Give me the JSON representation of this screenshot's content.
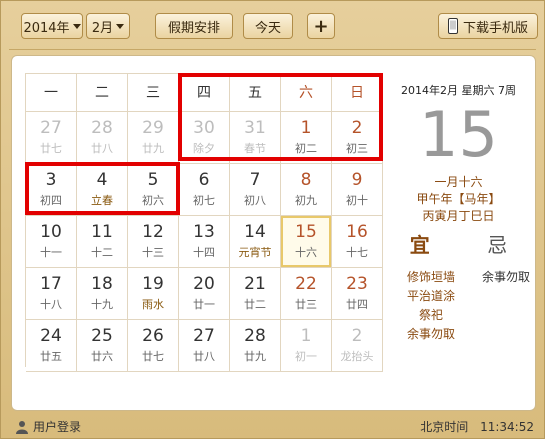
{
  "toolbar": {
    "year": "2014年",
    "month": "2月",
    "holiday_btn": "假期安排",
    "today_btn": "今天",
    "plus_btn": "+",
    "download_btn": "下载手机版"
  },
  "weekdays": [
    "一",
    "二",
    "三",
    "四",
    "五",
    "六",
    "日"
  ],
  "days": [
    {
      "d": "27",
      "l": "廿七",
      "other": true
    },
    {
      "d": "28",
      "l": "廿八",
      "other": true
    },
    {
      "d": "29",
      "l": "廿九",
      "other": true
    },
    {
      "d": "30",
      "l": "除夕",
      "other": true
    },
    {
      "d": "31",
      "l": "春节",
      "other": true
    },
    {
      "d": "1",
      "l": "初二",
      "we": true
    },
    {
      "d": "2",
      "l": "初三",
      "we": true
    },
    {
      "d": "3",
      "l": "初四"
    },
    {
      "d": "4",
      "l": "立春",
      "fest": true
    },
    {
      "d": "5",
      "l": "初六"
    },
    {
      "d": "6",
      "l": "初七"
    },
    {
      "d": "7",
      "l": "初八"
    },
    {
      "d": "8",
      "l": "初九",
      "we": true
    },
    {
      "d": "9",
      "l": "初十",
      "we": true
    },
    {
      "d": "10",
      "l": "十一"
    },
    {
      "d": "11",
      "l": "十二"
    },
    {
      "d": "12",
      "l": "十三"
    },
    {
      "d": "13",
      "l": "十四"
    },
    {
      "d": "14",
      "l": "元宵节",
      "fest": true
    },
    {
      "d": "15",
      "l": "十六",
      "we": true,
      "today": true
    },
    {
      "d": "16",
      "l": "十七",
      "we": true
    },
    {
      "d": "17",
      "l": "十八"
    },
    {
      "d": "18",
      "l": "十九"
    },
    {
      "d": "19",
      "l": "雨水",
      "fest": true
    },
    {
      "d": "20",
      "l": "廿一"
    },
    {
      "d": "21",
      "l": "廿二"
    },
    {
      "d": "22",
      "l": "廿三",
      "we": true
    },
    {
      "d": "23",
      "l": "廿四",
      "we": true
    },
    {
      "d": "24",
      "l": "廿五"
    },
    {
      "d": "25",
      "l": "廿六"
    },
    {
      "d": "26",
      "l": "廿七"
    },
    {
      "d": "27",
      "l": "廿八"
    },
    {
      "d": "28",
      "l": "廿九"
    },
    {
      "d": "1",
      "l": "初一",
      "other": true
    },
    {
      "d": "2",
      "l": "龙抬头",
      "other": true,
      "fest": true
    }
  ],
  "side": {
    "header": "2014年2月 星期六 7周",
    "big_day": "15",
    "lunar": "一月十六",
    "ganzhi_year": "甲午年【马年】",
    "ganzhi_day": "丙寅月丁巳日",
    "yi": "宜",
    "ji": "忌",
    "yi_items": [
      "修饰垣墙",
      "平治道涂",
      "祭祀",
      "余事勿取"
    ],
    "ji_items": [
      "余事勿取"
    ]
  },
  "footer": {
    "login": "用户登录",
    "time_label": "北京时间",
    "time": "11:34:52"
  },
  "colors": {
    "highlight": "#e20000",
    "accent": "#8a4a10",
    "weekend": "#b5532a"
  }
}
